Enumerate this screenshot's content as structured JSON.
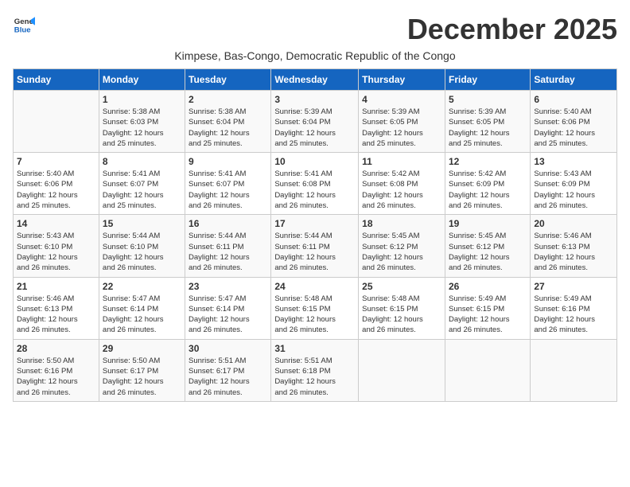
{
  "header": {
    "logo_line1": "General",
    "logo_line2": "Blue",
    "title": "December 2025",
    "subtitle": "Kimpese, Bas-Congo, Democratic Republic of the Congo"
  },
  "days_of_week": [
    "Sunday",
    "Monday",
    "Tuesday",
    "Wednesday",
    "Thursday",
    "Friday",
    "Saturday"
  ],
  "weeks": [
    [
      {
        "day": "",
        "info": ""
      },
      {
        "day": "1",
        "info": "Sunrise: 5:38 AM\nSunset: 6:03 PM\nDaylight: 12 hours\nand 25 minutes."
      },
      {
        "day": "2",
        "info": "Sunrise: 5:38 AM\nSunset: 6:04 PM\nDaylight: 12 hours\nand 25 minutes."
      },
      {
        "day": "3",
        "info": "Sunrise: 5:39 AM\nSunset: 6:04 PM\nDaylight: 12 hours\nand 25 minutes."
      },
      {
        "day": "4",
        "info": "Sunrise: 5:39 AM\nSunset: 6:05 PM\nDaylight: 12 hours\nand 25 minutes."
      },
      {
        "day": "5",
        "info": "Sunrise: 5:39 AM\nSunset: 6:05 PM\nDaylight: 12 hours\nand 25 minutes."
      },
      {
        "day": "6",
        "info": "Sunrise: 5:40 AM\nSunset: 6:06 PM\nDaylight: 12 hours\nand 25 minutes."
      }
    ],
    [
      {
        "day": "7",
        "info": "Sunrise: 5:40 AM\nSunset: 6:06 PM\nDaylight: 12 hours\nand 25 minutes."
      },
      {
        "day": "8",
        "info": "Sunrise: 5:41 AM\nSunset: 6:07 PM\nDaylight: 12 hours\nand 25 minutes."
      },
      {
        "day": "9",
        "info": "Sunrise: 5:41 AM\nSunset: 6:07 PM\nDaylight: 12 hours\nand 26 minutes."
      },
      {
        "day": "10",
        "info": "Sunrise: 5:41 AM\nSunset: 6:08 PM\nDaylight: 12 hours\nand 26 minutes."
      },
      {
        "day": "11",
        "info": "Sunrise: 5:42 AM\nSunset: 6:08 PM\nDaylight: 12 hours\nand 26 minutes."
      },
      {
        "day": "12",
        "info": "Sunrise: 5:42 AM\nSunset: 6:09 PM\nDaylight: 12 hours\nand 26 minutes."
      },
      {
        "day": "13",
        "info": "Sunrise: 5:43 AM\nSunset: 6:09 PM\nDaylight: 12 hours\nand 26 minutes."
      }
    ],
    [
      {
        "day": "14",
        "info": "Sunrise: 5:43 AM\nSunset: 6:10 PM\nDaylight: 12 hours\nand 26 minutes."
      },
      {
        "day": "15",
        "info": "Sunrise: 5:44 AM\nSunset: 6:10 PM\nDaylight: 12 hours\nand 26 minutes."
      },
      {
        "day": "16",
        "info": "Sunrise: 5:44 AM\nSunset: 6:11 PM\nDaylight: 12 hours\nand 26 minutes."
      },
      {
        "day": "17",
        "info": "Sunrise: 5:44 AM\nSunset: 6:11 PM\nDaylight: 12 hours\nand 26 minutes."
      },
      {
        "day": "18",
        "info": "Sunrise: 5:45 AM\nSunset: 6:12 PM\nDaylight: 12 hours\nand 26 minutes."
      },
      {
        "day": "19",
        "info": "Sunrise: 5:45 AM\nSunset: 6:12 PM\nDaylight: 12 hours\nand 26 minutes."
      },
      {
        "day": "20",
        "info": "Sunrise: 5:46 AM\nSunset: 6:13 PM\nDaylight: 12 hours\nand 26 minutes."
      }
    ],
    [
      {
        "day": "21",
        "info": "Sunrise: 5:46 AM\nSunset: 6:13 PM\nDaylight: 12 hours\nand 26 minutes."
      },
      {
        "day": "22",
        "info": "Sunrise: 5:47 AM\nSunset: 6:14 PM\nDaylight: 12 hours\nand 26 minutes."
      },
      {
        "day": "23",
        "info": "Sunrise: 5:47 AM\nSunset: 6:14 PM\nDaylight: 12 hours\nand 26 minutes."
      },
      {
        "day": "24",
        "info": "Sunrise: 5:48 AM\nSunset: 6:15 PM\nDaylight: 12 hours\nand 26 minutes."
      },
      {
        "day": "25",
        "info": "Sunrise: 5:48 AM\nSunset: 6:15 PM\nDaylight: 12 hours\nand 26 minutes."
      },
      {
        "day": "26",
        "info": "Sunrise: 5:49 AM\nSunset: 6:15 PM\nDaylight: 12 hours\nand 26 minutes."
      },
      {
        "day": "27",
        "info": "Sunrise: 5:49 AM\nSunset: 6:16 PM\nDaylight: 12 hours\nand 26 minutes."
      }
    ],
    [
      {
        "day": "28",
        "info": "Sunrise: 5:50 AM\nSunset: 6:16 PM\nDaylight: 12 hours\nand 26 minutes."
      },
      {
        "day": "29",
        "info": "Sunrise: 5:50 AM\nSunset: 6:17 PM\nDaylight: 12 hours\nand 26 minutes."
      },
      {
        "day": "30",
        "info": "Sunrise: 5:51 AM\nSunset: 6:17 PM\nDaylight: 12 hours\nand 26 minutes."
      },
      {
        "day": "31",
        "info": "Sunrise: 5:51 AM\nSunset: 6:18 PM\nDaylight: 12 hours\nand 26 minutes."
      },
      {
        "day": "",
        "info": ""
      },
      {
        "day": "",
        "info": ""
      },
      {
        "day": "",
        "info": ""
      }
    ]
  ]
}
